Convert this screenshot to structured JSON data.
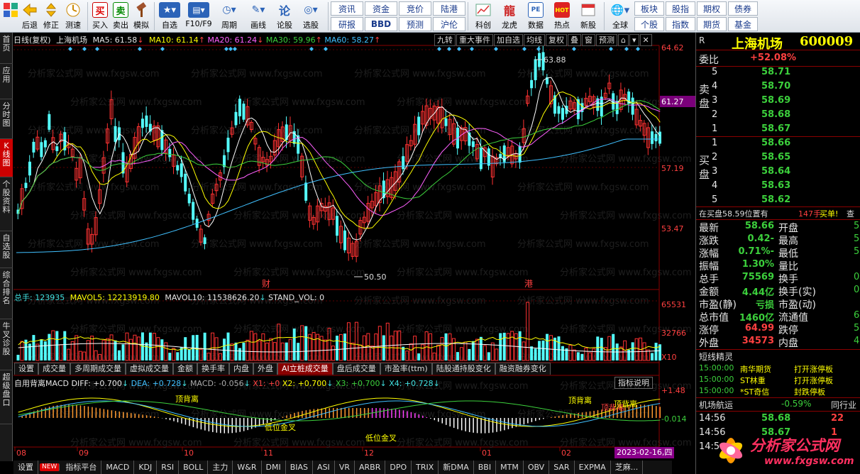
{
  "toolbar": {
    "items": [
      {
        "label": "",
        "icon": "app-logo-icon"
      },
      {
        "label": "后退",
        "icon": "back-arrow-icon"
      },
      {
        "label": "修正",
        "icon": "updown-icon"
      },
      {
        "label": "测速",
        "icon": "speed-icon"
      },
      {
        "label": "买入",
        "icon": "buy-icon"
      },
      {
        "label": "卖出",
        "icon": "sell-icon"
      },
      {
        "label": "模拟",
        "icon": "gavel-icon"
      },
      {
        "label": "自选",
        "icon": "star-icon"
      },
      {
        "label": "F10/F9",
        "icon": "f10-icon"
      },
      {
        "label": "周期",
        "icon": "clock-icon"
      },
      {
        "label": "画线",
        "icon": "pen-icon"
      },
      {
        "label": "论股",
        "icon": "talk-icon"
      },
      {
        "label": "选股",
        "icon": "select-icon"
      }
    ],
    "grid1": [
      "资讯",
      "资金",
      "竞价",
      "陆港",
      "研报",
      "BBD",
      "预测",
      "沪伦"
    ],
    "icons2": [
      {
        "label": "科创",
        "icon": "chart-icon"
      },
      {
        "label": "龙虎",
        "icon": "dragon-icon"
      },
      {
        "label": "数据",
        "icon": "pe-icon"
      },
      {
        "label": "热点",
        "icon": "hot-icon"
      },
      {
        "label": "新股",
        "icon": "newstock-icon"
      },
      {
        "label": "全球",
        "icon": "globe-icon"
      }
    ],
    "grid2": [
      "板块",
      "股指",
      "期权",
      "债券",
      "个股",
      "指数",
      "期货",
      "基金"
    ]
  },
  "left_tabs": [
    "首页",
    "应用",
    "分时图",
    "K线图",
    "个股资料",
    "自选股",
    "综合排名",
    "牛叉诊股",
    "超级盘口"
  ],
  "active_left_tab": "K线图",
  "chart": {
    "header": {
      "period": "日线(复权)",
      "name": "上海机场",
      "ma5": "MA5: 61.58",
      "ma10": "MA10: 61.14",
      "ma20": "MA20: 61.24",
      "ma30": "MA30: 59.96",
      "ma60": "MA60: 58.27"
    },
    "buttons": [
      "九转",
      "重大事件",
      "加自选",
      "均线",
      "复权",
      "叠",
      "窗",
      "预测"
    ],
    "price_axis": [
      "64.62",
      "61.27",
      "57.19",
      "53.47"
    ],
    "current_price_tag": "61.27",
    "high_label": "63.88",
    "low_label": "50.50",
    "event_labels": [
      "财",
      "港"
    ],
    "volume_header": {
      "total": "总手: 123935",
      "mavol5": "MAVOL5: 12213919.80",
      "mavol10": "MAVOL10: 11538626.20",
      "stand": "STAND_VOL: 0"
    },
    "volume_axis": [
      "65531",
      "32766",
      "X10"
    ],
    "indicator_tabs": [
      "设置",
      "成交量",
      "多周期成交量",
      "虚拟成交量",
      "金额",
      "换手率",
      "内盘",
      "外盘",
      "AI立桩成交量",
      "盘后成交量",
      "市盈率(ttm)",
      "陆股通持股变化",
      "融资融券变化"
    ],
    "selected_indicator_tab": "AI立桩成交量",
    "macd_header": {
      "name": "自用背离MACD",
      "diff": "DIFF: +0.700",
      "dea": "DEA: +0.728",
      "macd": "MACD: -0.056",
      "x1": "X1: +0",
      "x2": "X2: +0.700",
      "x3": "X3: +0.700",
      "x4": "X4: +0.728"
    },
    "macd_explain_btn": "指标说明",
    "macd_axis": [
      "+1.48",
      "-0.014"
    ],
    "macd_annotations": [
      "顶背离",
      "低位金叉",
      "低位金叉",
      "顶背离",
      "顶背离",
      "顶背离"
    ],
    "date_axis": [
      "08",
      "09",
      "10",
      "11",
      "12",
      "01",
      "02"
    ],
    "date_cursor": "2023-02-16,四",
    "bottom_tabs": [
      "设置",
      "NEW",
      "指标平台",
      "MACD",
      "KDJ",
      "RSI",
      "BOLL",
      "主力",
      "W&R",
      "DMI",
      "BIAS",
      "ASI",
      "VR",
      "ARBR",
      "DPO",
      "TRIX",
      "新DMA",
      "BBI",
      "MTM",
      "OBV",
      "SAR",
      "EXPMA",
      "芝麻..."
    ],
    "watermark": "分析家公式网 www.fxgsw.com"
  },
  "quote": {
    "r_label": "R",
    "title": "上海机场",
    "code": "600009",
    "weibi_label": "委比",
    "weibi": "+52.08%",
    "sell_label": "卖盘",
    "buy_label": "买盘",
    "asks": [
      {
        "lvl": "5",
        "price": "58.71"
      },
      {
        "lvl": "4",
        "price": "58.70"
      },
      {
        "lvl": "3",
        "price": "58.69"
      },
      {
        "lvl": "2",
        "price": "58.68"
      },
      {
        "lvl": "1",
        "price": "58.67"
      }
    ],
    "bids": [
      {
        "lvl": "1",
        "price": "58.66"
      },
      {
        "lvl": "2",
        "price": "58.65"
      },
      {
        "lvl": "3",
        "price": "58.64"
      },
      {
        "lvl": "4",
        "price": "58.63"
      },
      {
        "lvl": "5",
        "price": "58.62"
      }
    ],
    "notice": "在买盘58.59位置有",
    "notice_qty": "147手",
    "notice_act": "买单!",
    "notice_more": "查",
    "stats_left": [
      {
        "k": "最新",
        "v": "58.66"
      },
      {
        "k": "涨跌",
        "v": "-0.42"
      },
      {
        "k": "涨幅",
        "v": "-0.71%"
      },
      {
        "k": "振幅",
        "v": "1.30%"
      },
      {
        "k": "总手",
        "v": "75569"
      },
      {
        "k": "金额",
        "v": "4.44亿"
      },
      {
        "k": "市盈(静)",
        "v": "亏损"
      },
      {
        "k": "总市值",
        "v": "1460亿"
      },
      {
        "k": "涨停",
        "v": "64.99"
      },
      {
        "k": "外盘",
        "v": "34573"
      }
    ],
    "stats_right": [
      {
        "k": "开盘",
        "v": "5"
      },
      {
        "k": "最高",
        "v": "5"
      },
      {
        "k": "最低",
        "v": "5"
      },
      {
        "k": "量比",
        "v": ""
      },
      {
        "k": "换手",
        "v": "0"
      },
      {
        "k": "换手(实)",
        "v": "0"
      },
      {
        "k": "市盈(动)",
        "v": ""
      },
      {
        "k": "流通值",
        "v": "64"
      },
      {
        "k": "跌停",
        "v": "5"
      },
      {
        "k": "内盘",
        "v": "4"
      }
    ],
    "short_title": "短线精灵",
    "short_items": [
      {
        "t": "15:00:00",
        "name": "南华期货",
        "ev": "打开涨停板"
      },
      {
        "t": "15:00:00",
        "name": "ST林重",
        "ev": "打开涨停板"
      },
      {
        "t": "15:00:00",
        "name": "*ST奇信",
        "ev": "封跌停板"
      }
    ],
    "sector_name": "机场航运",
    "sector_chg": "-0.59%",
    "sector_more": "同行业",
    "ticks": [
      {
        "t": "14:56",
        "p": "58.68",
        "v": "22"
      },
      {
        "t": "14:56",
        "p": "58.67",
        "v": "1"
      },
      {
        "t": "14:5",
        "p": "",
        "v": ""
      }
    ],
    "logo_text": "分析家公式网",
    "logo_url": "www.fxgsw.com"
  }
}
